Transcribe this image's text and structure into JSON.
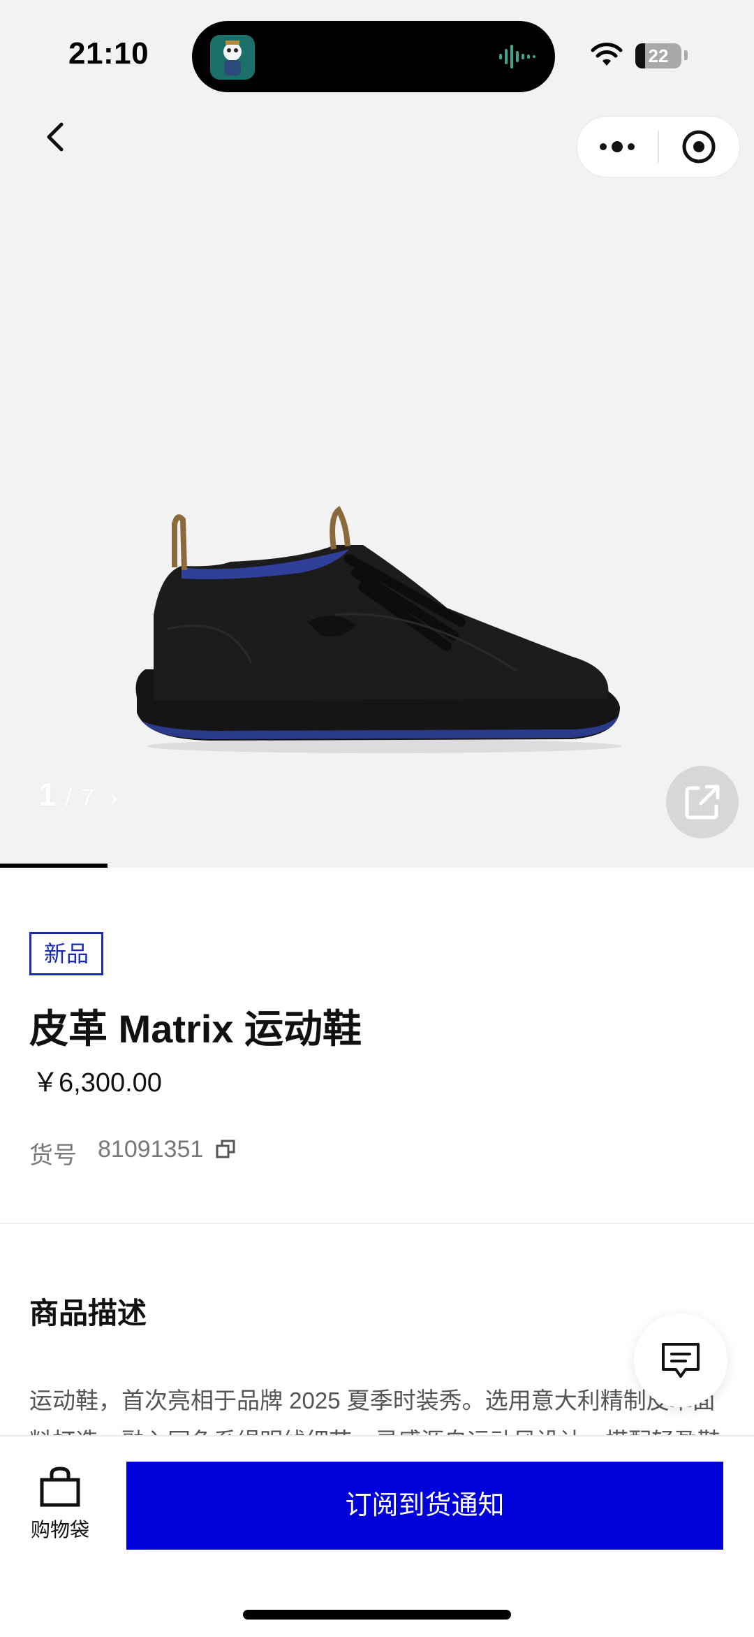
{
  "status_bar": {
    "time": "21:10",
    "battery": "22"
  },
  "gallery": {
    "current": "1",
    "separator": "/",
    "total": "7",
    "chevron": "›",
    "progress_fraction": 0.143
  },
  "product": {
    "badge": "新品",
    "title": "皮革 Matrix 运动鞋",
    "price": "￥6,300.00",
    "sku_label": "货号",
    "sku_value": "81091351"
  },
  "description": {
    "heading": "商品描述",
    "text": "运动鞋，首次亮相于品牌 2025 夏季时装秀。选用意大利精制皮革面料打造，融入同色系缉明线细节，灵感源自运动风设计，搭配轻盈鞋"
  },
  "bottom_bar": {
    "bag_label": "购物袋",
    "notify_label": "订阅到货通知"
  },
  "colors": {
    "accent": "#0000d8",
    "badge_border": "#1a2ab0",
    "gallery_bg": "#f2f2f3"
  }
}
